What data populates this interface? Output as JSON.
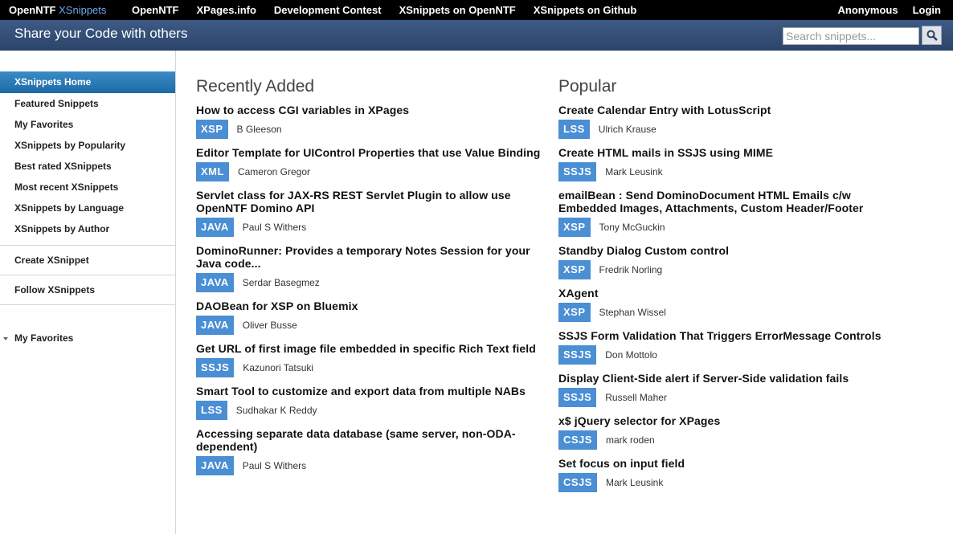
{
  "topbar": {
    "brand_main": "OpenNTF",
    "brand_sub": "XSnippets",
    "links": [
      "OpenNTF",
      "XPages.info",
      "Development Contest",
      "XSnippets on OpenNTF",
      "XSnippets on Github"
    ],
    "user": "Anonymous",
    "login": "Login"
  },
  "banner": {
    "tagline": "Share your Code with others",
    "search_placeholder": "Search snippets..."
  },
  "sidebar": {
    "items": [
      "XSnippets Home",
      "Featured Snippets",
      "My Favorites",
      "XSnippets by Popularity",
      "Best rated XSnippets",
      "Most recent XSnippets",
      "XSnippets by Language",
      "XSnippets by Author"
    ],
    "create": "Create XSnippet",
    "follow": "Follow XSnippets",
    "favorites_section": "My Favorites"
  },
  "recent": {
    "heading": "Recently Added",
    "entries": [
      {
        "title": "How to access CGI variables in XPages",
        "tag": "XSP",
        "author": "B Gleeson"
      },
      {
        "title": "Editor Template for UIControl Properties that use Value Binding",
        "tag": "XML",
        "author": "Cameron Gregor"
      },
      {
        "title": "Servlet class for JAX-RS REST Servlet Plugin to allow use OpenNTF Domino API",
        "tag": "JAVA",
        "author": "Paul S Withers"
      },
      {
        "title": "DominoRunner: Provides a temporary Notes Session for your Java code...",
        "tag": "JAVA",
        "author": "Serdar Basegmez"
      },
      {
        "title": "DAOBean for XSP on Bluemix",
        "tag": "JAVA",
        "author": "Oliver Busse"
      },
      {
        "title": "Get URL of first image file embedded in specific Rich Text field",
        "tag": "SSJS",
        "author": "Kazunori Tatsuki"
      },
      {
        "title": "Smart Tool to customize and export data from multiple NABs",
        "tag": "LSS",
        "author": "Sudhakar K Reddy"
      },
      {
        "title": "Accessing separate data database (same server, non-ODA-dependent)",
        "tag": "JAVA",
        "author": "Paul S Withers"
      }
    ]
  },
  "popular": {
    "heading": "Popular",
    "entries": [
      {
        "title": "Create Calendar Entry with LotusScript",
        "tag": "LSS",
        "author": "Ulrich Krause"
      },
      {
        "title": "Create HTML mails in SSJS using MIME",
        "tag": "SSJS",
        "author": "Mark Leusink"
      },
      {
        "title": "emailBean : Send DominoDocument HTML Emails c/w Embedded Images, Attachments, Custom Header/Footer",
        "tag": "XSP",
        "author": "Tony McGuckin"
      },
      {
        "title": "Standby Dialog Custom control",
        "tag": "XSP",
        "author": "Fredrik Norling"
      },
      {
        "title": "XAgent",
        "tag": "XSP",
        "author": "Stephan Wissel"
      },
      {
        "title": "SSJS Form Validation That Triggers ErrorMessage Controls",
        "tag": "SSJS",
        "author": "Don Mottolo"
      },
      {
        "title": "Display Client-Side alert if Server-Side validation fails",
        "tag": "SSJS",
        "author": "Russell Maher"
      },
      {
        "title": "x$ jQuery selector for XPages",
        "tag": "CSJS",
        "author": "mark roden"
      },
      {
        "title": "Set focus on input field",
        "tag": "CSJS",
        "author": "Mark Leusink"
      }
    ]
  },
  "icons": {
    "search": "search-icon",
    "caret": "caret-down-icon"
  },
  "colors": {
    "topbar": "#000000",
    "banner": "#34507a",
    "active": "#2a7abb",
    "tag": "#4a8ed4"
  }
}
